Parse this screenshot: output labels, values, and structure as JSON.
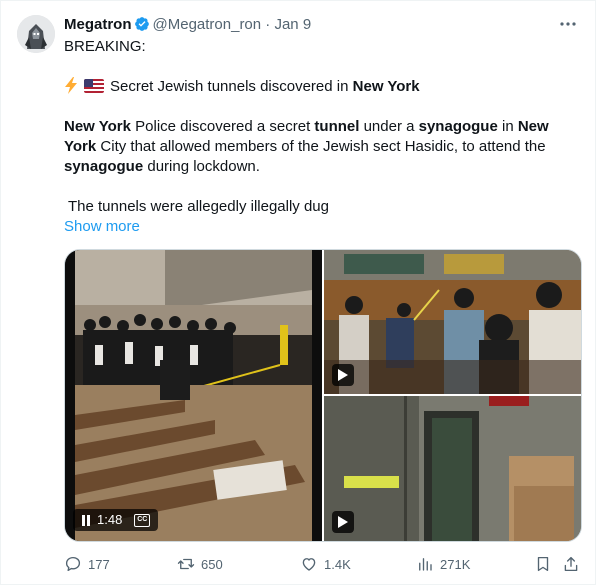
{
  "tweet": {
    "display_name": "Megatron",
    "handle": "@Megatron_ron",
    "separator": "·",
    "date": "Jan 9",
    "more_icon": "more-horizontal-icon",
    "line1": "BREAKING:",
    "headline_prefix": "Secret Jewish tunnels discovered in",
    "headline_bold": "New York",
    "body": {
      "b1": "New York",
      "p1": " Police discovered a secret ",
      "b2": "tunnel",
      "p2": " under a ",
      "b3": "synagogue",
      "p3": " in ",
      "b4": "New York",
      "p4": " City that allowed members of the Jewish sect Hasidic, to attend the ",
      "b5": "synagogue",
      "p5": " during lockdown."
    },
    "line4": "The tunnels were allegedly illegally dug",
    "show_more": "Show more",
    "video_time": "1:48",
    "cc_label": "CC"
  },
  "actions": {
    "replies": "177",
    "reposts": "650",
    "likes": "1.4K",
    "views": "271K"
  },
  "colors": {
    "accent": "#1d9bf0",
    "secondary_text": "#536471",
    "border": "#cfd9de"
  }
}
